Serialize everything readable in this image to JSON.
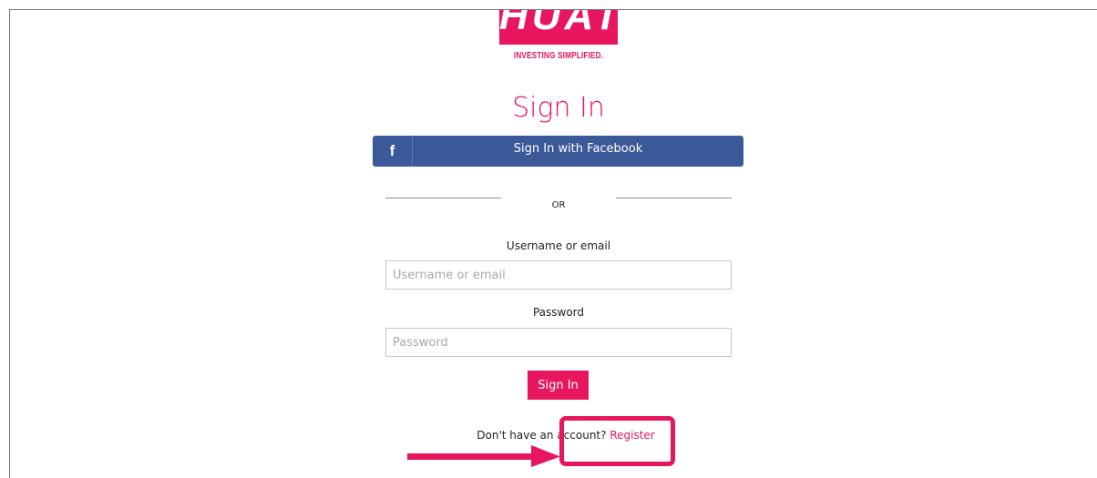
{
  "brand": {
    "logo_text": "HUAT",
    "tagline": "INVESTING SIMPLIFIED.",
    "accent_color": "#e8175d",
    "facebook_color": "#3b5998"
  },
  "page": {
    "title": "Sign In"
  },
  "facebook": {
    "icon": "f",
    "label": "Sign In with Facebook"
  },
  "divider": {
    "label": "OR"
  },
  "form": {
    "username_label": "Username or email",
    "username_placeholder": "Username or email",
    "username_value": "",
    "password_label": "Password",
    "password_placeholder": "Password",
    "password_value": "",
    "submit_label": "Sign In"
  },
  "register": {
    "prompt": "Don't have an account? ",
    "link_label": "Register"
  },
  "annotation": {
    "highlight_color": "#e8175d",
    "arrow_color": "#e8175d"
  }
}
